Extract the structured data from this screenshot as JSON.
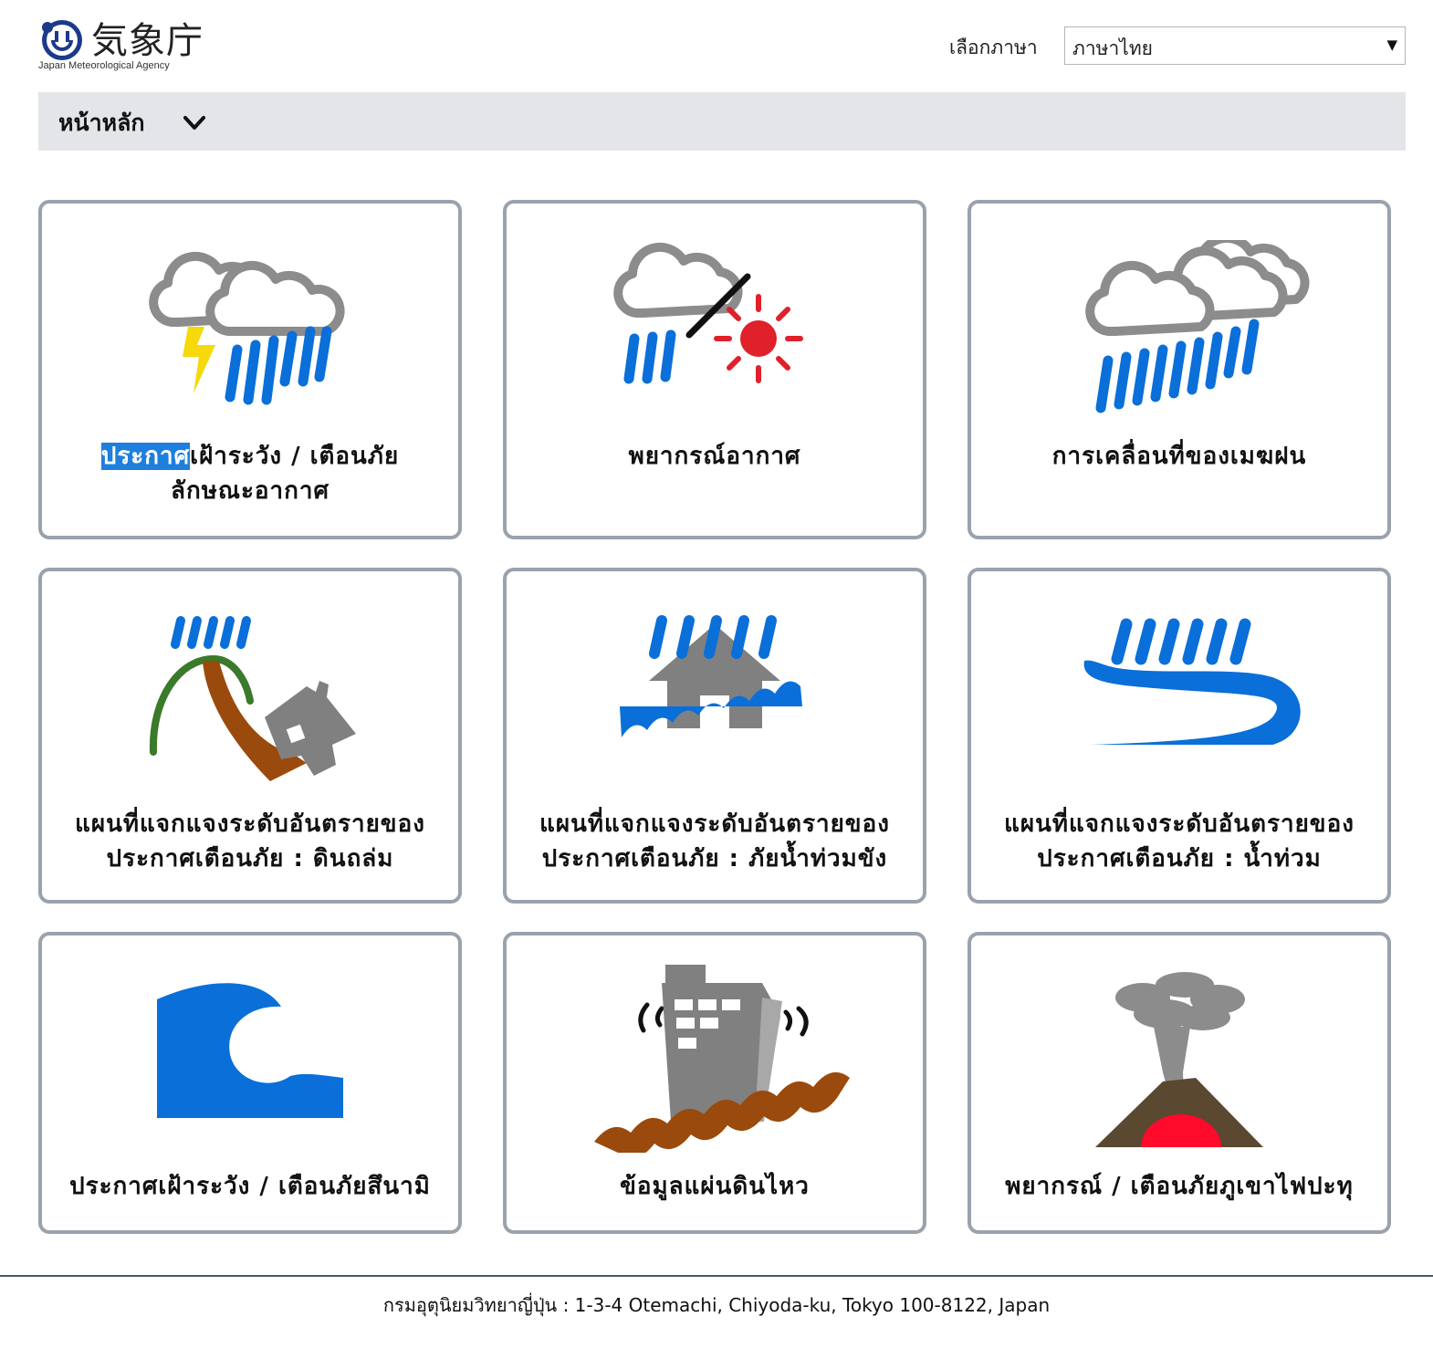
{
  "logo": {
    "jp_text": "気象庁",
    "en_text": "Japan Meteorological Agency"
  },
  "language": {
    "label": "เลือกภาษา",
    "selected": "ภาษาไทย"
  },
  "nav": {
    "home": "หน้าหลัก"
  },
  "cards": [
    {
      "icon": "thunderstorm-rain-icon",
      "line1_highlight": "ประกาศ",
      "line1_rest": "เฝ้าระวัง / เตือนภัย",
      "line2": "ลักษณะอากาศ"
    },
    {
      "icon": "rain-or-sun-forecast-icon",
      "line1": "พยากรณ์อากาศ"
    },
    {
      "icon": "heavy-rain-clouds-icon",
      "line1": "การเคลื่อนที่ของเมฆฝน"
    },
    {
      "icon": "landslide-icon",
      "line1": "แผนที่แจกแจงระดับอันตรายของ",
      "line2": "ประกาศเตือนภัย : ดินถล่ม"
    },
    {
      "icon": "inundation-house-icon",
      "line1": "แผนที่แจกแจงระดับอันตรายของ",
      "line2": "ประกาศเตือนภัย : ภัยน้ำท่วมขัง"
    },
    {
      "icon": "river-flood-icon",
      "line1": "แผนที่แจกแจงระดับอันตรายของ",
      "line2": "ประกาศเตือนภัย : น้ำท่วม"
    },
    {
      "icon": "tsunami-wave-icon",
      "line1": "ประกาศเฝ้าระวัง / เตือนภัยสึนามิ"
    },
    {
      "icon": "earthquake-building-icon",
      "line1": "ข้อมูลแผ่นดินไหว"
    },
    {
      "icon": "volcano-icon",
      "line1": "พยากรณ์ / เตือนภัยภูเขาไฟปะทุ"
    }
  ],
  "colors": {
    "rain_blue": "#0a6fd8",
    "cloud_gray": "#8c8c8c",
    "bolt_yellow": "#f5d90a",
    "sun_red": "#e0202a",
    "card_border": "#9aa2ac",
    "nav_bg": "#e3e5e8",
    "highlight": "#1e7fdc"
  },
  "footer": {
    "text": "กรมอุตุนิยมวิทยาญี่ปุ่น : 1-3-4 Otemachi, Chiyoda-ku, Tokyo 100-8122, Japan"
  }
}
